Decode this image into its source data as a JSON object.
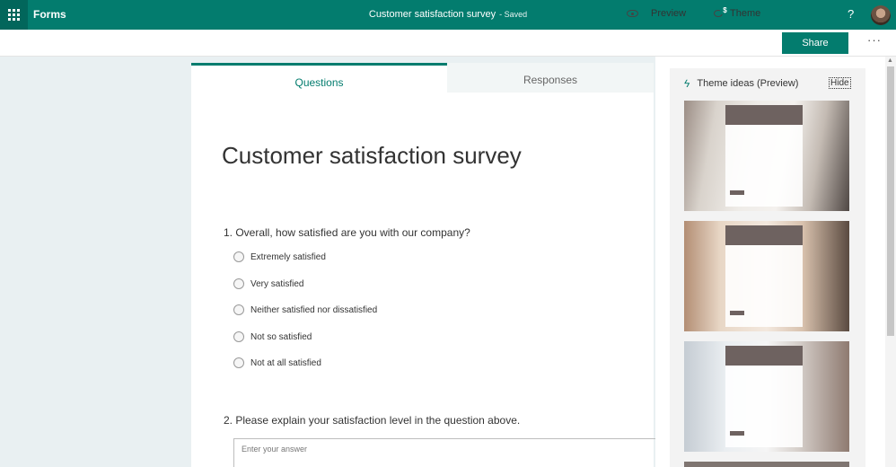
{
  "topbar": {
    "app_name": "Forms",
    "doc_title": "Customer satisfaction survey",
    "saved_status": "- Saved",
    "help_glyph": "?"
  },
  "commands": {
    "preview_label": "Preview",
    "theme_label": "Theme",
    "theme_badge": "$",
    "share_label": "Share",
    "more_glyph": "···"
  },
  "tabs": {
    "questions_label": "Questions",
    "responses_label": "Responses"
  },
  "form": {
    "title": "Customer satisfaction survey",
    "questions": [
      {
        "label": "1. Overall, how satisfied are you with our company?",
        "options": [
          "Extremely satisfied",
          "Very satisfied",
          "Neither satisfied nor dissatisfied",
          "Not so satisfied",
          "Not at all satisfied"
        ]
      },
      {
        "label": "2. Please explain your satisfaction level in the question above.",
        "placeholder": "Enter your answer"
      }
    ]
  },
  "theme_panel": {
    "title": "Theme ideas (Preview)",
    "hide_label": "Hide"
  },
  "colors": {
    "brand": "#037c6e",
    "brand_dark": "#02665b",
    "theme_bar": "#6e6260",
    "canvas": "#e9f0f2"
  },
  "icons": {
    "app_launcher": "waffle-icon",
    "preview": "eye-icon",
    "theme": "palette-icon",
    "theme_ideas": "lightning-icon"
  }
}
